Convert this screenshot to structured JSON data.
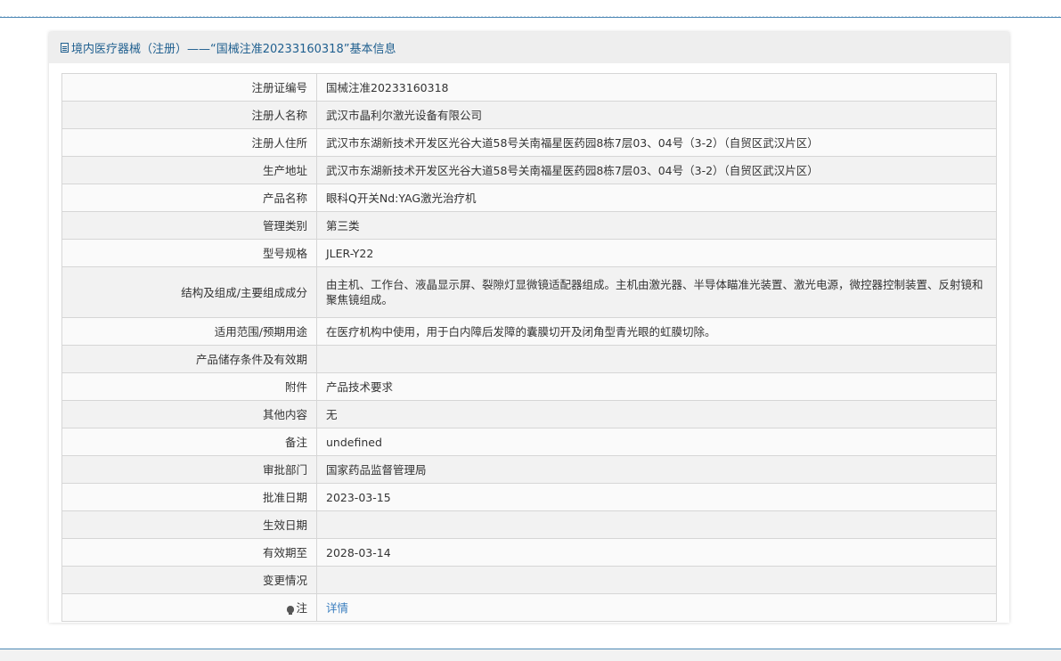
{
  "header": {
    "icon": "document-icon",
    "title": "境内医疗器械（注册）——“国械注准20233160318”基本信息"
  },
  "rows": [
    {
      "label": "注册证编号",
      "value": "国械注准20233160318"
    },
    {
      "label": "注册人名称",
      "value": "武汉市晶利尔激光设备有限公司"
    },
    {
      "label": "注册人住所",
      "value": "武汉市东湖新技术开发区光谷大道58号关南福星医药园8栋7层03、04号（3-2）（自贸区武汉片区）"
    },
    {
      "label": "生产地址",
      "value": "武汉市东湖新技术开发区光谷大道58号关南福星医药园8栋7层03、04号（3-2）（自贸区武汉片区）"
    },
    {
      "label": "产品名称",
      "value": "眼科Q开关Nd:YAG激光治疗机"
    },
    {
      "label": "管理类别",
      "value": "第三类"
    },
    {
      "label": "型号规格",
      "value": "JLER-Y22"
    },
    {
      "label": "结构及组成/主要组成成分",
      "value": "由主机、工作台、液晶显示屏、裂隙灯显微镜适配器组成。主机由激光器、半导体瞄准光装置、激光电源，微控器控制装置、反射镜和聚焦镜组成。"
    },
    {
      "label": "适用范围/预期用途",
      "value": "在医疗机构中使用，用于白内障后发障的囊膜切开及闭角型青光眼的虹膜切除。"
    },
    {
      "label": "产品储存条件及有效期",
      "value": ""
    },
    {
      "label": "附件",
      "value": "产品技术要求"
    },
    {
      "label": "其他内容",
      "value": "无"
    },
    {
      "label": "备注",
      "value": "undefined"
    },
    {
      "label": "审批部门",
      "value": "国家药品监督管理局"
    },
    {
      "label": "批准日期",
      "value": "2023-03-15"
    },
    {
      "label": "生效日期",
      "value": ""
    },
    {
      "label": "有效期至",
      "value": "2028-03-14"
    },
    {
      "label": "变更情况",
      "value": ""
    },
    {
      "label": "注",
      "value": "详情",
      "icon": "bulb-icon"
    }
  ]
}
